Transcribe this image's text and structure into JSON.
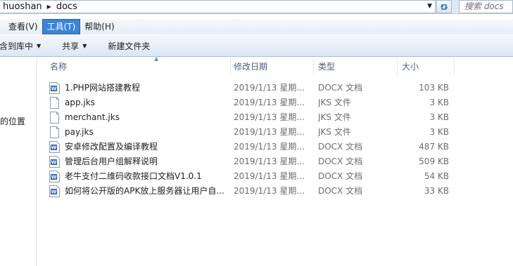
{
  "address": {
    "crumbs": [
      "huoshan",
      "docs"
    ],
    "search_placeholder": "搜索 docs"
  },
  "menu": [
    {
      "label": "查看(V)"
    },
    {
      "label": "工具(T)",
      "active": true
    },
    {
      "label": "帮助(H)"
    }
  ],
  "toolbar": {
    "include_library": "含到库中",
    "share": "共享",
    "new_folder": "新建文件夹"
  },
  "nav": {
    "location_label": "的位置"
  },
  "columns": {
    "name": "名称",
    "date": "修改日期",
    "type": "类型",
    "size": "大小"
  },
  "files": [
    {
      "name": "1.PHP网站搭建教程",
      "date": "2019/1/13 星期...",
      "type": "DOCX 文档",
      "size": "103 KB",
      "icon": "word-doc-icon"
    },
    {
      "name": "app.jks",
      "date": "2019/1/13 星期...",
      "type": "JKS 文件",
      "size": "3 KB",
      "icon": "blank-file-icon"
    },
    {
      "name": "merchant.jks",
      "date": "2019/1/13 星期...",
      "type": "JKS 文件",
      "size": "3 KB",
      "icon": "blank-file-icon"
    },
    {
      "name": "pay.jks",
      "date": "2019/1/13 星期...",
      "type": "JKS 文件",
      "size": "3 KB",
      "icon": "blank-file-icon"
    },
    {
      "name": "安卓修改配置及编译教程",
      "date": "2019/1/13 星期...",
      "type": "DOCX 文档",
      "size": "487 KB",
      "icon": "word-doc-icon"
    },
    {
      "name": "管理后台用户组解释说明",
      "date": "2019/1/13 星期...",
      "type": "DOCX 文档",
      "size": "509 KB",
      "icon": "word-doc-icon"
    },
    {
      "name": "老牛支付二维码收款接口文档V1.0.1",
      "date": "2019/1/13 星期...",
      "type": "DOCX 文档",
      "size": "54 KB",
      "icon": "word-doc-icon"
    },
    {
      "name": "如何将公开版的APK放上服务器让用户自...",
      "date": "2019/1/13 星期...",
      "type": "DOCX 文档",
      "size": "33 KB",
      "icon": "word-doc-icon"
    }
  ],
  "colors": {
    "menu_active_bg": "#3d84d6",
    "header_text": "#4c607a",
    "secondary_text": "#6d6d6d",
    "word_icon_blue": "#2b5fad"
  }
}
